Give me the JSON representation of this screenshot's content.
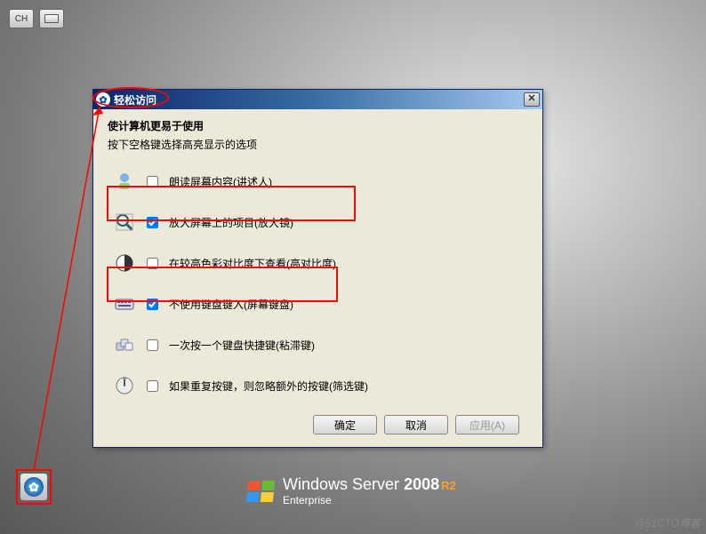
{
  "top": {
    "lang": "CH"
  },
  "dialog": {
    "title": "轻松访问",
    "heading": "使计算机更易于使用",
    "subheading": "按下空格键选择高亮显示的选项",
    "opts": [
      {
        "label": "朗读屏幕内容(讲述人)",
        "checked": false
      },
      {
        "label": "放大屏幕上的项目(放大镜)",
        "checked": true
      },
      {
        "label": "在较高色彩对比度下查看(高对比度)",
        "checked": false
      },
      {
        "label": "不使用键盘键入(屏幕键盘)",
        "checked": true
      },
      {
        "label": "一次按一个键盘快捷键(粘滞键)",
        "checked": false
      },
      {
        "label": "如果重复按键，则忽略额外的按键(筛选键)",
        "checked": false
      }
    ],
    "buttons": {
      "ok": "确定",
      "cancel": "取消",
      "apply": "应用(A)"
    }
  },
  "logo": {
    "brand": "Windows Server",
    "year": "2008",
    "suffix": "R2",
    "edition": "Enterprise"
  },
  "watermark": "@51CTO博客"
}
